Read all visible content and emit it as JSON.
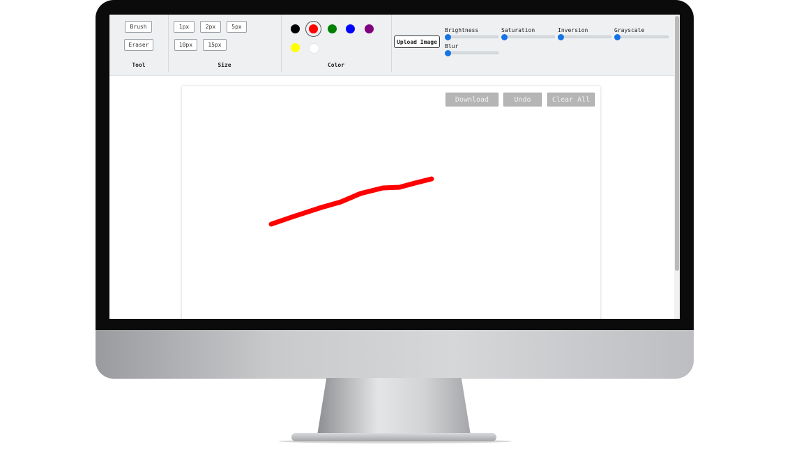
{
  "toolbar": {
    "tool": {
      "label": "Tool",
      "brush": "Brush",
      "eraser": "Eraser"
    },
    "size": {
      "label": "Size",
      "options": [
        "1px",
        "2px",
        "5px",
        "10px",
        "15px"
      ]
    },
    "color": {
      "label": "Color",
      "swatches": [
        "#000000",
        "#ff0000",
        "#008000",
        "#0000ff",
        "#800080",
        "#ffff00",
        "#ffffff"
      ],
      "selected": "#ff0000"
    },
    "upload_label": "Upload Image",
    "filters": {
      "brightness": {
        "label": "Brightness"
      },
      "saturation": {
        "label": "Saturation"
      },
      "inversion": {
        "label": "Inversion"
      },
      "grayscale": {
        "label": "Grayscale"
      },
      "blur": {
        "label": "Blur"
      }
    }
  },
  "canvas": {
    "download_label": "Download",
    "undo_label": "Undo",
    "clear_label": "Clear All",
    "stroke_color": "#ff0000"
  }
}
